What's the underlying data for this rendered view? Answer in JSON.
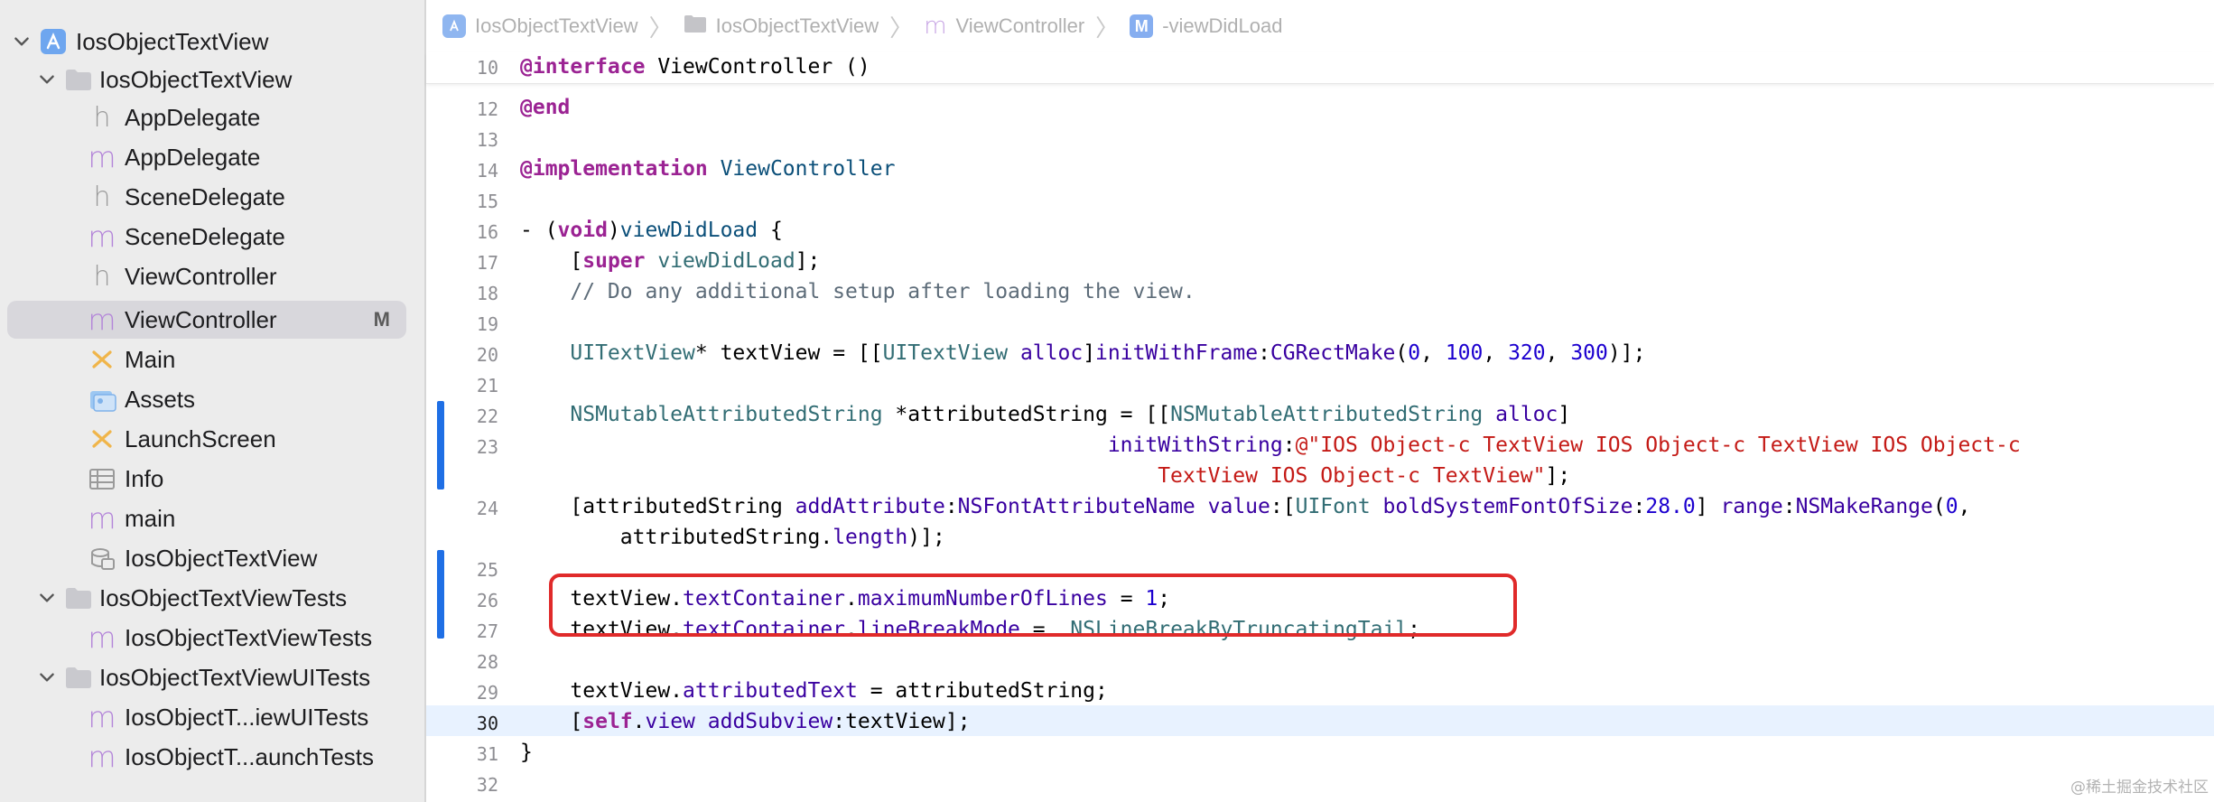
{
  "sidebar": {
    "project": {
      "label": "IosObjectTextView"
    },
    "group_main": {
      "label": "IosObjectTextView"
    },
    "files": [
      {
        "label": "AppDelegate",
        "kind": "h-icon"
      },
      {
        "label": "AppDelegate",
        "kind": "m-icon"
      },
      {
        "label": "SceneDelegate",
        "kind": "h-icon"
      },
      {
        "label": "SceneDelegate",
        "kind": "m-icon"
      },
      {
        "label": "ViewController",
        "kind": "h-icon"
      },
      {
        "label": "ViewController",
        "kind": "m-icon",
        "badge": "M"
      },
      {
        "label": "Main",
        "kind": "storyboard-icon"
      },
      {
        "label": "Assets",
        "kind": "assets-icon"
      },
      {
        "label": "LaunchScreen",
        "kind": "storyboard-icon"
      },
      {
        "label": "Info",
        "kind": "plist-icon"
      },
      {
        "label": "main",
        "kind": "m-icon"
      },
      {
        "label": "IosObjectTextView",
        "kind": "datamodel-icon"
      }
    ],
    "group_tests": {
      "label": "IosObjectTextViewTests"
    },
    "tests_files": [
      {
        "label": "IosObjectTextViewTests",
        "kind": "m-icon"
      }
    ],
    "group_uitests": {
      "label": "IosObjectTextViewUITests"
    },
    "uitests_files": [
      {
        "label": "IosObjectT...iewUITests",
        "kind": "m-icon"
      },
      {
        "label": "IosObjectT...aunchTests",
        "kind": "m-icon"
      }
    ]
  },
  "jumpbar": {
    "items": [
      "IosObjectTextView",
      "IosObjectTextView",
      "ViewController",
      "-viewDidLoad"
    ],
    "m_icon": "M"
  },
  "editor": {
    "sticky": {
      "num": "10",
      "text_kw": "@interface",
      "text_rest": " ViewController ()"
    },
    "lines": {
      "n12": "12",
      "l12": "@end",
      "n13": "13",
      "n14": "14",
      "l14a": "@implementation",
      "l14b": " ViewController",
      "n15": "15",
      "n16": "16",
      "l16a": "- (",
      "l16b": "void",
      "l16c": ")",
      "l16d": "viewDidLoad",
      "l16e": " {",
      "n17": "17",
      "l17a": "    [",
      "l17b": "super",
      "l17c": " ",
      "l17d": "viewDidLoad",
      "l17e": "];",
      "n18": "18",
      "l18": "    // Do any additional setup after loading the view.",
      "n19": "19",
      "n20": "20",
      "l20a": "    ",
      "l20b": "UITextView",
      "l20c": "* textView = [[",
      "l20d": "UITextView",
      "l20e": " ",
      "l20f": "alloc",
      "l20g": "]",
      "l20h": "initWithFrame",
      "l20i": ":",
      "l20j": "CGRectMake",
      "l20k": "(",
      "l20l": "0",
      "l20m": ", ",
      "l20n": "100",
      "l20o": ", ",
      "l20p": "320",
      "l20q": ", ",
      "l20r": "300",
      "l20s": ")];",
      "n21": "21",
      "n22": "22",
      "l22a": "    ",
      "l22b": "NSMutableAttributedString",
      "l22c": " *attributedString = [[",
      "l22d": "NSMutableAttributedString",
      "l22e": " ",
      "l22f": "alloc",
      "l22g": "]",
      "n23": "23",
      "l23a": "                                               ",
      "l23b": "initWithString",
      "l23c": ":",
      "l23d": "@\"IOS Object-c TextView IOS Object-c TextView IOS Object-c",
      "l23cont": "                                                   TextView IOS Object-c TextView\"",
      "l23end": "];",
      "n24": "24",
      "l24a": "    [attributedString ",
      "l24b": "addAttribute",
      "l24c": ":",
      "l24d": "NSFontAttributeName",
      "l24e": " ",
      "l24f": "value",
      "l24g": ":[",
      "l24h": "UIFont",
      "l24i": " ",
      "l24j": "boldSystemFontOfSize",
      "l24k": ":",
      "l24l": "28.0",
      "l24m": "] ",
      "l24n": "range",
      "l24o": ":",
      "l24p": "NSMakeRange",
      "l24q": "(",
      "l24r": "0",
      "l24s": ",",
      "l24cont_a": "        attributedString.",
      "l24cont_b": "length",
      "l24cont_c": ")];",
      "n25": "25",
      "n26": "26",
      "l26a": "    textView.",
      "l26b": "textContainer",
      "l26c": ".",
      "l26d": "maximumNumberOfLines",
      "l26e": " = ",
      "l26f": "1",
      "l26g": ";",
      "n27": "27",
      "l27a": "    textView.",
      "l27b": "textContainer",
      "l27c": ".",
      "l27d": "lineBreakMode",
      "l27e": " =  ",
      "l27f": "NSLineBreakByTruncatingTail",
      "l27g": ";",
      "n28": "28",
      "n29": "29",
      "l29a": "    textView.",
      "l29b": "attributedText",
      "l29c": " = attributedString;",
      "n30": "30",
      "l30a": "    [",
      "l30b": "self",
      "l30c": ".",
      "l30d": "view",
      "l30e": " ",
      "l30f": "addSubview",
      "l30g": ":textView];",
      "n31": "31",
      "l31": "}",
      "n32": "32"
    }
  },
  "watermark": "@稀土掘金技术社区",
  "colors": {
    "keyword": "#9b2393",
    "type": "#0b4f79",
    "string": "#c41a16",
    "number": "#1c00cf",
    "highlight": "#e02a2a",
    "changebar": "#1f6fe5"
  }
}
